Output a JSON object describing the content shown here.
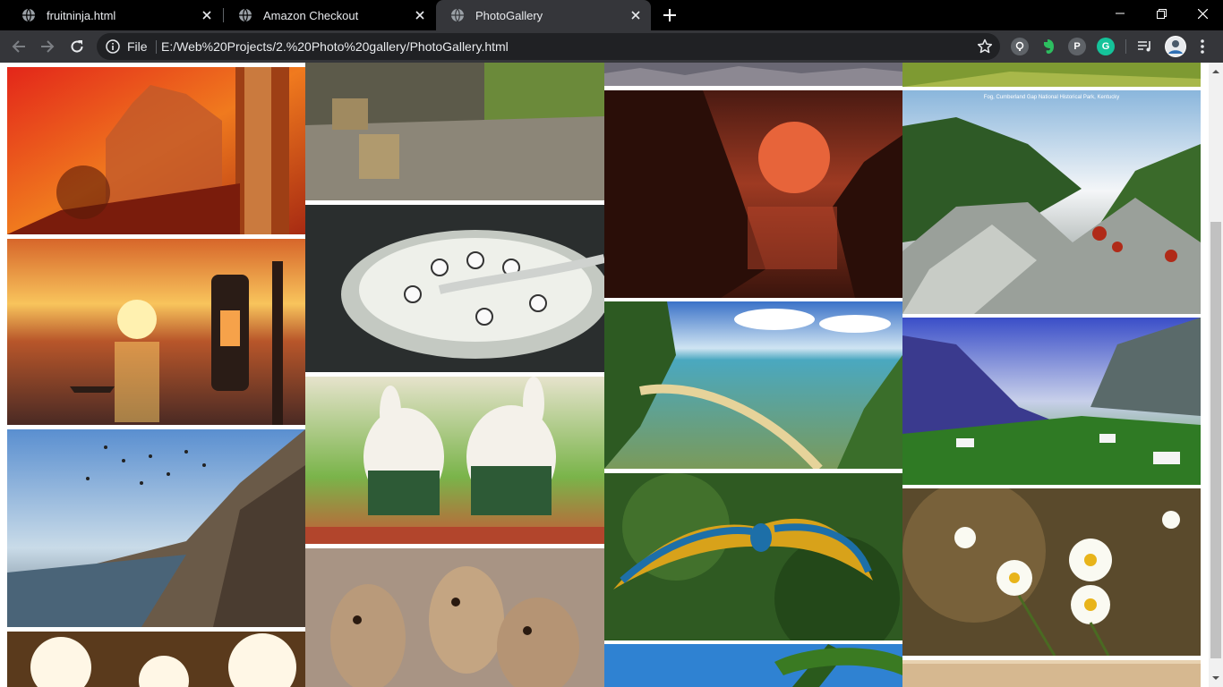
{
  "browser": {
    "tabs": [
      {
        "title": "fruitninja.html",
        "active": false
      },
      {
        "title": "Amazon Checkout",
        "active": false
      },
      {
        "title": "PhotoGallery",
        "active": true
      }
    ],
    "address": {
      "scheme_label": "File",
      "url": "E:/Web%20Projects/2.%20Photo%20gallery/PhotoGallery.html"
    },
    "icons": {
      "back": "arrow-left-icon",
      "forward": "arrow-right-icon",
      "reload": "reload-icon",
      "site_info": "info-icon",
      "bookmark": "star-icon",
      "extensions": [
        "lens-extension-icon",
        "evernote-icon",
        "pinterest-icon",
        "grammarly-icon",
        "media-control-icon"
      ],
      "profile": "avatar"
    },
    "extension_letters": {
      "pinterest": "P",
      "grammarly": "G"
    }
  },
  "gallery": {
    "photos": [
      {
        "name": "photo-palace-sunset",
        "caption": ""
      },
      {
        "name": "photo-danbo-road",
        "caption": ""
      },
      {
        "name": "photo-stormtrooper-cereal",
        "caption": ""
      },
      {
        "name": "photo-rabbids-race",
        "caption": ""
      },
      {
        "name": "photo-meerkats",
        "caption": ""
      },
      {
        "name": "photo-rocks-top",
        "caption": ""
      },
      {
        "name": "photo-red-sun-cove",
        "caption": ""
      },
      {
        "name": "photo-tropical-beach",
        "caption": ""
      },
      {
        "name": "photo-macaw-flight",
        "caption": ""
      },
      {
        "name": "photo-palm-sky",
        "caption": ""
      },
      {
        "name": "photo-green-field-top",
        "caption": ""
      },
      {
        "name": "photo-fog-mountains",
        "caption": "Fog, Cumberland Gap National Historical Park, Kentucky"
      },
      {
        "name": "photo-alpine-valley",
        "caption": ""
      },
      {
        "name": "photo-daisies-rain",
        "caption": ""
      },
      {
        "name": "photo-sand-bottom",
        "caption": ""
      },
      {
        "name": "photo-lantern-sunset",
        "caption": ""
      },
      {
        "name": "photo-ghats-birds",
        "caption": ""
      },
      {
        "name": "photo-gear-lights",
        "caption": ""
      }
    ]
  },
  "colors": {
    "tabstrip": "#000000",
    "toolbar": "#35363a",
    "omnibox": "#202124",
    "text": "#e8eaed",
    "page_bg": "#ffffff"
  }
}
